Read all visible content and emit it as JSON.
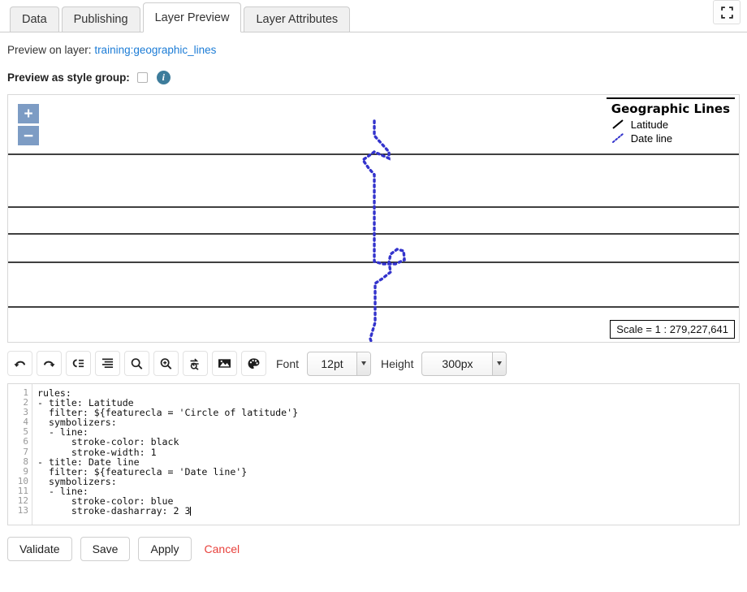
{
  "tabs": [
    {
      "label": "Data",
      "active": false
    },
    {
      "label": "Publishing",
      "active": false
    },
    {
      "label": "Layer Preview",
      "active": true
    },
    {
      "label": "Layer Attributes",
      "active": false
    }
  ],
  "fullscreen_icon": "fullscreen-icon",
  "preview": {
    "on_layer_label": "Preview on layer:",
    "layer_name": "training:geographic_lines",
    "style_group_label": "Preview as style group:",
    "style_group_checked": false,
    "info_icon_glyph": "i"
  },
  "map": {
    "zoom_in_label": "+",
    "zoom_out_label": "−",
    "legend_title": "Geographic Lines",
    "legend_items": [
      {
        "label": "Latitude",
        "color": "#000000",
        "style": "solid"
      },
      {
        "label": "Date line",
        "color": "#3030d0",
        "style": "dotted"
      }
    ],
    "scale_text": "Scale = 1 : 279,227,641",
    "latitude_line_color": "#000000",
    "dateline_color": "#3333cc"
  },
  "toolbar": {
    "buttons": [
      {
        "name": "undo-icon",
        "title": "Undo"
      },
      {
        "name": "redo-icon",
        "title": "Redo"
      },
      {
        "name": "format-icon",
        "title": "Format"
      },
      {
        "name": "indent-icon",
        "title": "Indent"
      },
      {
        "name": "search-icon",
        "title": "Search"
      },
      {
        "name": "zoom-in-icon",
        "title": "Find next"
      },
      {
        "name": "replace-icon",
        "title": "Replace"
      },
      {
        "name": "image-icon",
        "title": "Insert image"
      },
      {
        "name": "palette-icon",
        "title": "Color picker"
      }
    ],
    "font_label": "Font",
    "font_value": "12pt",
    "height_label": "Height",
    "height_value": "300px"
  },
  "editor": {
    "line_numbers": [
      "1",
      "2",
      "3",
      "4",
      "5",
      "6",
      "7",
      "8",
      "9",
      "10",
      "11",
      "12",
      "13"
    ],
    "code": "rules:\n- title: Latitude\n  filter: ${featurecla = 'Circle of latitude'}\n  symbolizers:\n  - line:\n      stroke-color: black\n      stroke-width: 1\n- title: Date line\n  filter: ${featurecla = 'Date line'}\n  symbolizers:\n  - line:\n      stroke-color: blue\n      stroke-dasharray: 2 3"
  },
  "actions": {
    "validate_label": "Validate",
    "save_label": "Save",
    "apply_label": "Apply",
    "cancel_label": "Cancel",
    "cancel_color": "#e8413c"
  }
}
